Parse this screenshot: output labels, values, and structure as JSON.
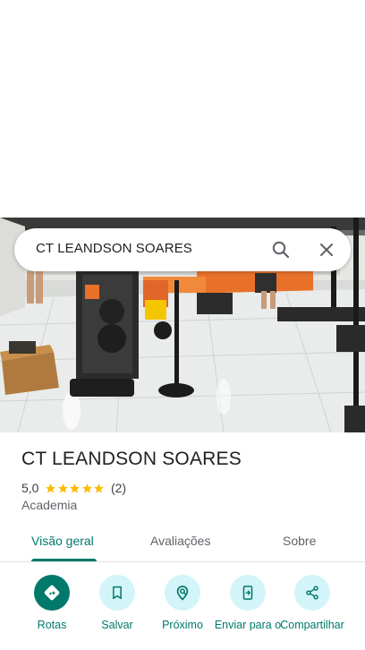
{
  "search": {
    "query": "CT LEANDSON SOARES"
  },
  "place": {
    "name": "CT LEANDSON SOARES",
    "rating": "5,0",
    "stars": 5,
    "review_count": "(2)",
    "category": "Academia"
  },
  "tabs": [
    {
      "label": "Visão geral",
      "active": true
    },
    {
      "label": "Avaliações",
      "active": false
    },
    {
      "label": "Sobre",
      "active": false
    }
  ],
  "actions": [
    {
      "label": "Rotas",
      "icon": "directions-icon"
    },
    {
      "label": "Salvar",
      "icon": "bookmark-icon"
    },
    {
      "label": "Próximo",
      "icon": "nearby-icon"
    },
    {
      "label": "Enviar para o",
      "icon": "send-to-phone-icon"
    },
    {
      "label": "Compartilhar",
      "icon": "share-icon"
    }
  ],
  "colors": {
    "accent": "#00796b",
    "action_bg": "#d3f4f8",
    "star": "#fbbc04",
    "text_primary": "#202124",
    "text_secondary": "#5f6368"
  }
}
